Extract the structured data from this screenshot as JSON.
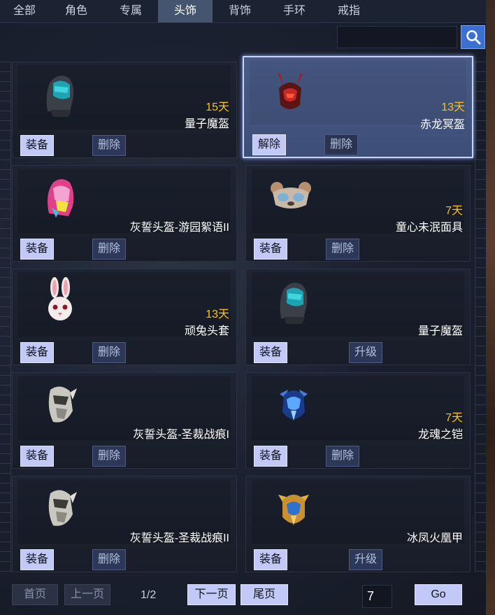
{
  "tabs": [
    {
      "label": "全部",
      "active": false
    },
    {
      "label": "角色",
      "active": false
    },
    {
      "label": "专属",
      "active": false
    },
    {
      "label": "头饰",
      "active": true
    },
    {
      "label": "背饰",
      "active": false
    },
    {
      "label": "手环",
      "active": false
    },
    {
      "label": "戒指",
      "active": false
    }
  ],
  "search": {
    "placeholder": "",
    "icon": "search-icon"
  },
  "items": [
    {
      "name": "量子魔盔",
      "days": "15天",
      "btn1": "装备",
      "btn2": "删除",
      "icon": "quantum-helmet-icon",
      "selected": false
    },
    {
      "name": "赤龙冥盔",
      "days": "13天",
      "btn1": "解除",
      "btn2": "删除",
      "icon": "red-dragon-helmet-icon",
      "selected": true
    },
    {
      "name": "灰誓头盔-游园絮语II",
      "days": "",
      "btn1": "装备",
      "btn2": "删除",
      "icon": "pink-helmet-icon",
      "selected": false
    },
    {
      "name": "童心未泯面具",
      "days": "7天",
      "btn1": "装备",
      "btn2": "删除",
      "icon": "bear-mask-icon",
      "selected": false
    },
    {
      "name": "顽兔头套",
      "days": "13天",
      "btn1": "装备",
      "btn2": "删除",
      "icon": "rabbit-head-icon",
      "selected": false
    },
    {
      "name": "量子魔盔",
      "days": "",
      "btn1": "装备",
      "btn2": "升级",
      "icon": "quantum-helmet-icon",
      "selected": false
    },
    {
      "name": "灰誓头盔-圣裁战痕I",
      "days": "",
      "btn1": "装备",
      "btn2": "删除",
      "icon": "silver-helmet-icon",
      "selected": false
    },
    {
      "name": "龙魂之铠",
      "days": "7天",
      "btn1": "装备",
      "btn2": "删除",
      "icon": "dragon-soul-helmet-icon",
      "selected": false
    },
    {
      "name": "灰誓头盔-圣裁战痕II",
      "days": "",
      "btn1": "装备",
      "btn2": "删除",
      "icon": "silver-helmet-icon",
      "selected": false
    },
    {
      "name": "冰凤火凰甲",
      "days": "",
      "btn1": "装备",
      "btn2": "升级",
      "icon": "phoenix-helmet-icon",
      "selected": false
    }
  ],
  "pagination": {
    "first": "首页",
    "prev": "上一页",
    "info": "1/2",
    "next": "下一页",
    "last": "尾页",
    "jump_value": "7",
    "go": "Go"
  },
  "colors": {
    "accent": "#3d6fd0",
    "days": "#ffc400",
    "button": "#c2c9f6",
    "selected": "#4a5c86"
  }
}
